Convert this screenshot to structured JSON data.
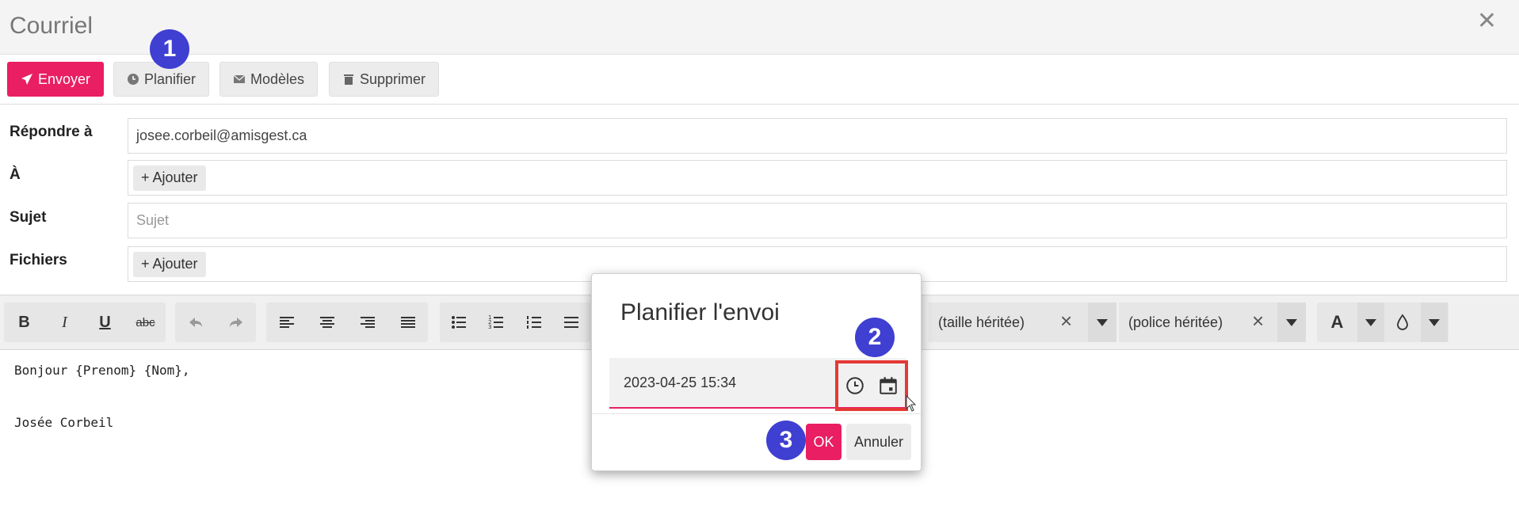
{
  "window": {
    "title": "Courriel"
  },
  "toolbar": {
    "send": "Envoyer",
    "schedule": "Planifier",
    "templates": "Modèles",
    "delete": "Supprimer"
  },
  "form": {
    "reply_to": {
      "label": "Répondre à",
      "value": "josee.corbeil@amisgest.ca"
    },
    "to": {
      "label": "À",
      "add": "Ajouter"
    },
    "subject": {
      "label": "Sujet",
      "placeholder": "Sujet"
    },
    "files": {
      "label": "Fichiers",
      "add": "Ajouter"
    }
  },
  "editor": {
    "toolbar": {
      "bold": "B",
      "italic": "I",
      "underline": "U",
      "strike": "abc",
      "font_size": "(taille héritée)",
      "font_family": "(police héritée)",
      "text_color": "A",
      "icons": [
        "undo-icon",
        "redo-icon",
        "align-left-icon",
        "align-center-icon",
        "align-right-icon",
        "align-justify-icon",
        "bullet-list-icon",
        "numbered-list-icon",
        "checklist-icon",
        "drop-icon"
      ]
    },
    "body": [
      "Bonjour {Prenom} {Nom},",
      "Josée Corbeil"
    ]
  },
  "dialog": {
    "title": "Planifier l'envoi",
    "datetime": "2023-04-25 15:34",
    "ok": "OK",
    "cancel": "Annuler"
  },
  "badges": [
    "1",
    "2",
    "3"
  ],
  "colors": {
    "accent": "#e91e63",
    "badge": "#3f3fd1",
    "highlight": "#e53935"
  }
}
